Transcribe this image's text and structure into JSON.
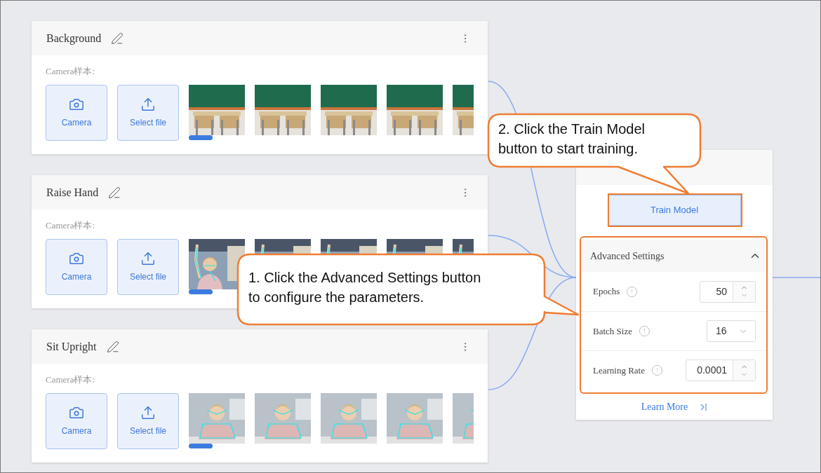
{
  "classes": [
    {
      "name": "Background",
      "section_label": "Camera样本:",
      "buttons": [
        {
          "kind": "camera",
          "label": "Camera"
        },
        {
          "kind": "upload",
          "label": "Select file"
        }
      ],
      "samples": [
        {
          "kind": "picture"
        },
        {
          "kind": "picture"
        },
        {
          "kind": "picture"
        },
        {
          "kind": "picture"
        },
        {
          "kind": "picture"
        }
      ]
    },
    {
      "name": "Raise Hand",
      "section_label": "Camera样本:",
      "buttons": [
        {
          "kind": "camera",
          "label": "Camera"
        },
        {
          "kind": "upload",
          "label": "Select file"
        }
      ],
      "samples": [
        {
          "kind": "picture"
        },
        {
          "kind": "picture"
        },
        {
          "kind": "picture"
        },
        {
          "kind": "picture"
        },
        {
          "kind": "picture"
        }
      ]
    },
    {
      "name": "Sit Upright",
      "section_label": "Camera样本:",
      "buttons": [
        {
          "kind": "camera",
          "label": "Camera"
        },
        {
          "kind": "upload",
          "label": "Select file"
        }
      ],
      "samples": [
        {
          "kind": "picture"
        },
        {
          "kind": "picture"
        },
        {
          "kind": "picture"
        },
        {
          "kind": "picture"
        },
        {
          "kind": "picture"
        }
      ]
    }
  ],
  "training": {
    "train_button": "Train Model",
    "advanced": {
      "title": "Advanced Settings",
      "expanded": true,
      "params": [
        {
          "label": "Epochs",
          "kind": "number",
          "value": "50"
        },
        {
          "label": "Batch Size",
          "kind": "select",
          "value": "16"
        },
        {
          "label": "Learning Rate",
          "kind": "number",
          "value": "0.0001"
        }
      ]
    },
    "link": "Learn More"
  },
  "callouts": [
    {
      "text": "1. Click the Advanced Settings button\nto configure the parameters."
    },
    {
      "text": "2. Click the Train Model\nbutton to start training."
    }
  ]
}
